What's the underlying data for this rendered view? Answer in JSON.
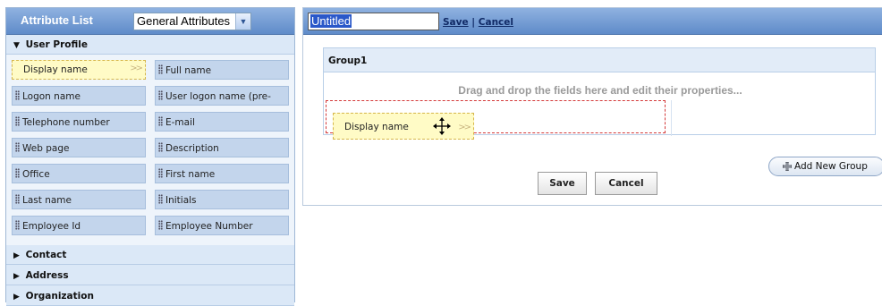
{
  "attribute_list": {
    "title": "Attribute List",
    "dropdown_value": "General Attributes",
    "sections": [
      {
        "label": "User Profile",
        "expanded": true
      },
      {
        "label": "Contact",
        "expanded": false
      },
      {
        "label": "Address",
        "expanded": false
      },
      {
        "label": "Organization",
        "expanded": false
      }
    ],
    "user_profile_attributes": [
      "Display name",
      "Full name",
      "Logon name",
      "User logon name (pre-",
      "Telephone number",
      "E-mail",
      "Web page",
      "Description",
      "Office",
      "First name",
      "Last name",
      "Initials",
      "Employee Id",
      "Employee Number"
    ],
    "selected_attribute": "Display name"
  },
  "form": {
    "title_value": "Untitled",
    "save_link": "Save",
    "link_separator": "|",
    "cancel_link": "Cancel",
    "group_name": "Group1",
    "drop_hint": "Drag and drop the fields here and edit their properties...",
    "dragging_field": "Display name",
    "add_group_label": "Add New Group",
    "save_button": "Save",
    "cancel_button": "Cancel"
  },
  "colors": {
    "header_blue": "#6f97d2",
    "panel_bg": "#dbe8f7",
    "attr_bg": "#c3d5ec",
    "selected_bg": "#fffbc6",
    "drop_zone_border": "#d43a3a",
    "hint_text": "#9a9a9a"
  }
}
